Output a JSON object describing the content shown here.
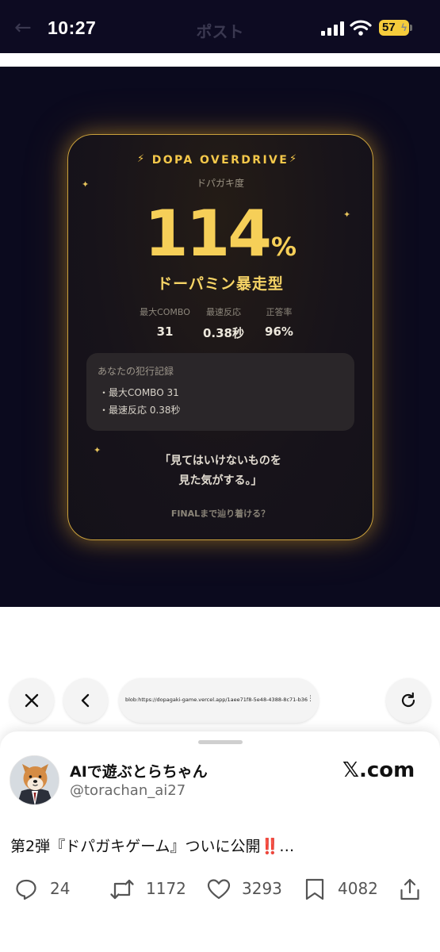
{
  "status_bar": {
    "time": "10:27",
    "title": "ポスト",
    "battery": "57"
  },
  "card": {
    "title": "DOPA OVERDRIVE",
    "subtitle": "ドパガキ度",
    "score": "114",
    "score_unit": "%",
    "type_label": "ドーパミン暴走型",
    "stats": [
      {
        "label": "最大COMBO",
        "value": "31"
      },
      {
        "label": "最速反応",
        "value": "0.38秒"
      },
      {
        "label": "正答率",
        "value": "96%"
      }
    ],
    "record": {
      "title": "あなたの犯行記録",
      "items": [
        "・最大COMBO 31",
        "・最速反応 0.38秒"
      ]
    },
    "quote": [
      "「見てはいけないものを",
      "見た気がする。」"
    ],
    "footer": "FINALまで辿り着ける？",
    "accent_color": "#f6cf58"
  },
  "browser": {
    "url": "blob:https://dopagaki-game.vercel.app/1aee71f8-5e48-4388-8c71-b3615d7e82ef"
  },
  "post": {
    "author_name": "AIで遊ぶとらちゃん",
    "author_handle": "@torachan_ai27",
    "site_label": "𝕏.com",
    "text": "第2弾『ドパガキゲーム』ついに公開",
    "text_emphasis": "‼️",
    "text_ellipsis": "…",
    "replies": "24",
    "reposts": "1172",
    "likes": "3293",
    "bookmarks": "4082"
  }
}
